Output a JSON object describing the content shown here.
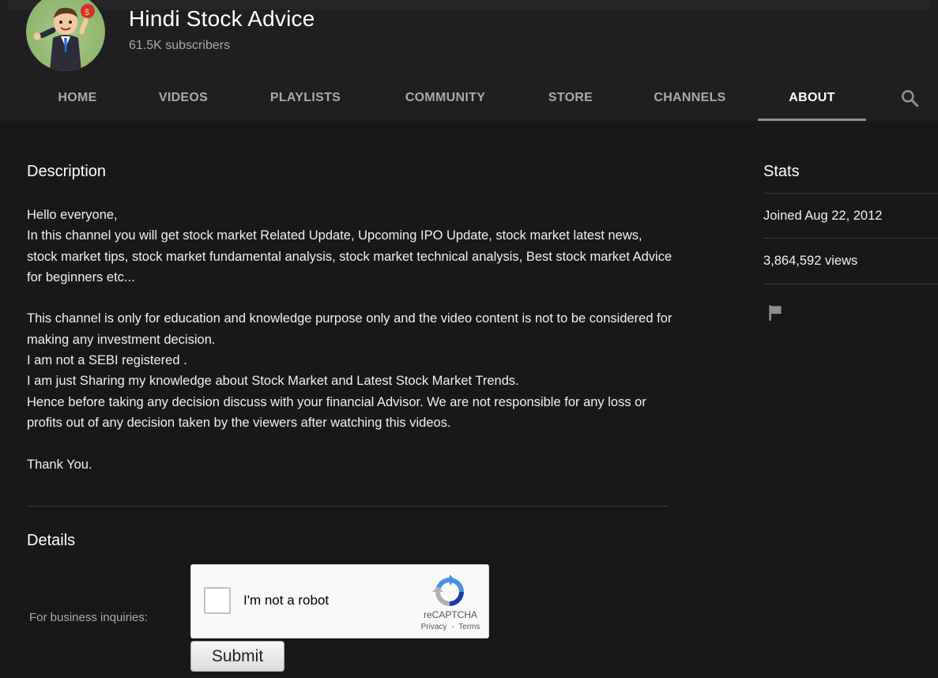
{
  "channel": {
    "name": "Hindi Stock Advice",
    "subscribers": "61.5K subscribers"
  },
  "tabs": [
    {
      "label": "HOME",
      "active": false
    },
    {
      "label": "VIDEOS",
      "active": false
    },
    {
      "label": "PLAYLISTS",
      "active": false
    },
    {
      "label": "COMMUNITY",
      "active": false
    },
    {
      "label": "STORE",
      "active": false
    },
    {
      "label": "CHANNELS",
      "active": false
    },
    {
      "label": "ABOUT",
      "active": true
    }
  ],
  "icons": {
    "search": "search-icon",
    "flag": "flag-icon",
    "avatar": "cartoon-businessman-avatar"
  },
  "description": {
    "heading": "Description",
    "text": "Hello everyone,\nIn this channel you will get stock market Related Update, Upcoming IPO Update, stock market latest news, stock market tips, stock market fundamental analysis, stock market technical analysis, Best stock market Advice for beginners etc...\n\nThis channel is only for education and knowledge purpose only and the video content is not to be considered for making any investment decision.\nI am not a SEBI registered .\nI am just Sharing my knowledge about Stock Market and Latest Stock Market Trends.\nHence before taking any decision discuss with your financial Advisor. We are not responsible for any loss or profits out of any decision taken by the viewers after watching this videos.\n\nThank You."
  },
  "details": {
    "heading": "Details",
    "business_label": "For business inquiries:",
    "recaptcha": {
      "checkbox_label": "I'm not a robot",
      "brand": "reCAPTCHA",
      "privacy": "Privacy",
      "separator": "-",
      "terms": "Terms"
    },
    "submit_label": "Submit"
  },
  "stats": {
    "heading": "Stats",
    "joined": "Joined Aug 22, 2012",
    "views": "3,864,592 views"
  },
  "colors": {
    "page_bg": "#181818",
    "header_bg": "#1f1f1f",
    "text_primary": "#f1f1f1",
    "text_secondary": "#aaaaaa",
    "divider": "#3a3a3a"
  }
}
